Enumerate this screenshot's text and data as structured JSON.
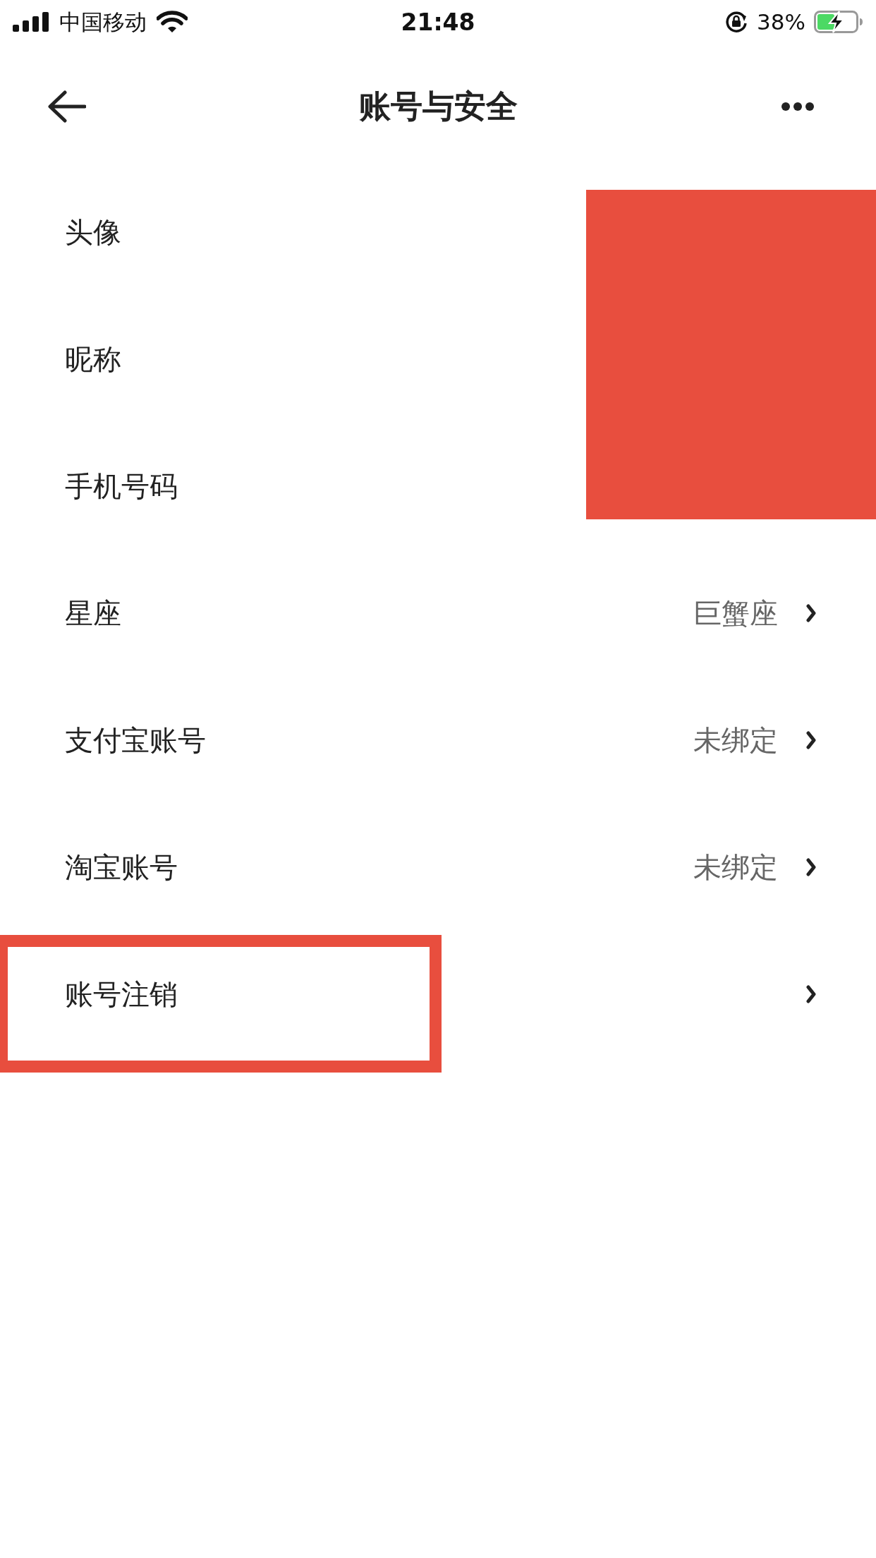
{
  "status_bar": {
    "carrier": "中国移动",
    "time": "21:48",
    "battery": "38%"
  },
  "header": {
    "title": "账号与安全"
  },
  "rows": [
    {
      "label": "头像",
      "redacted": true,
      "highlighted": false
    },
    {
      "label": "昵称",
      "redacted": true,
      "highlighted": false
    },
    {
      "label": "手机号码",
      "redacted": true,
      "highlighted": false
    },
    {
      "label": "星座",
      "value": "巨蟹座",
      "redacted": false,
      "highlighted": false
    },
    {
      "label": "支付宝账号",
      "value": "未绑定",
      "redacted": false,
      "highlighted": false
    },
    {
      "label": "淘宝账号",
      "value": "未绑定",
      "redacted": false,
      "highlighted": false
    },
    {
      "label": "账号注销",
      "redacted": false,
      "highlighted": true
    }
  ]
}
